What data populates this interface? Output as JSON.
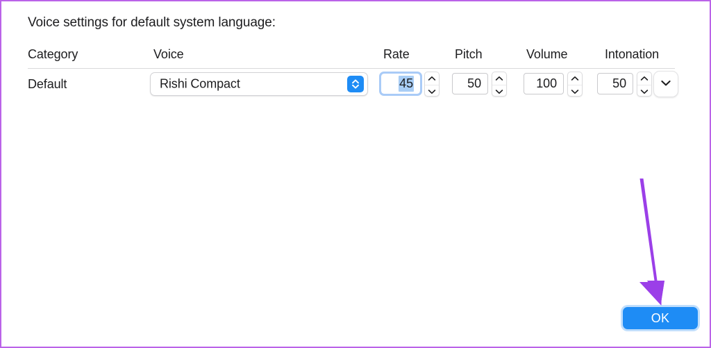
{
  "panel": {
    "title": "Voice settings for default system language:"
  },
  "table": {
    "headers": {
      "category": "Category",
      "voice": "Voice",
      "rate": "Rate",
      "pitch": "Pitch",
      "volume": "Volume",
      "intonation": "Intonation"
    },
    "row": {
      "category": "Default",
      "voice_selected": "Rishi Compact",
      "rate": "45",
      "pitch": "50",
      "volume": "100",
      "intonation": "50"
    }
  },
  "buttons": {
    "ok_label": "OK"
  },
  "icons": {
    "popup_updown": "chevron-up-down-icon",
    "stepper_up": "chevron-up-icon",
    "stepper_down": "chevron-down-icon",
    "disclosure": "chevron-down-icon",
    "annotation": "arrow-down-annotation"
  },
  "colors": {
    "accent_blue": "#1e8cf5",
    "focus_ring": "#a9cbf7",
    "selection_blue": "#a8cdf5",
    "annotation_purple": "#9b3fe8",
    "window_border": "#bb63e8",
    "text": "#1c1c1e",
    "separator": "#d9d9db"
  }
}
